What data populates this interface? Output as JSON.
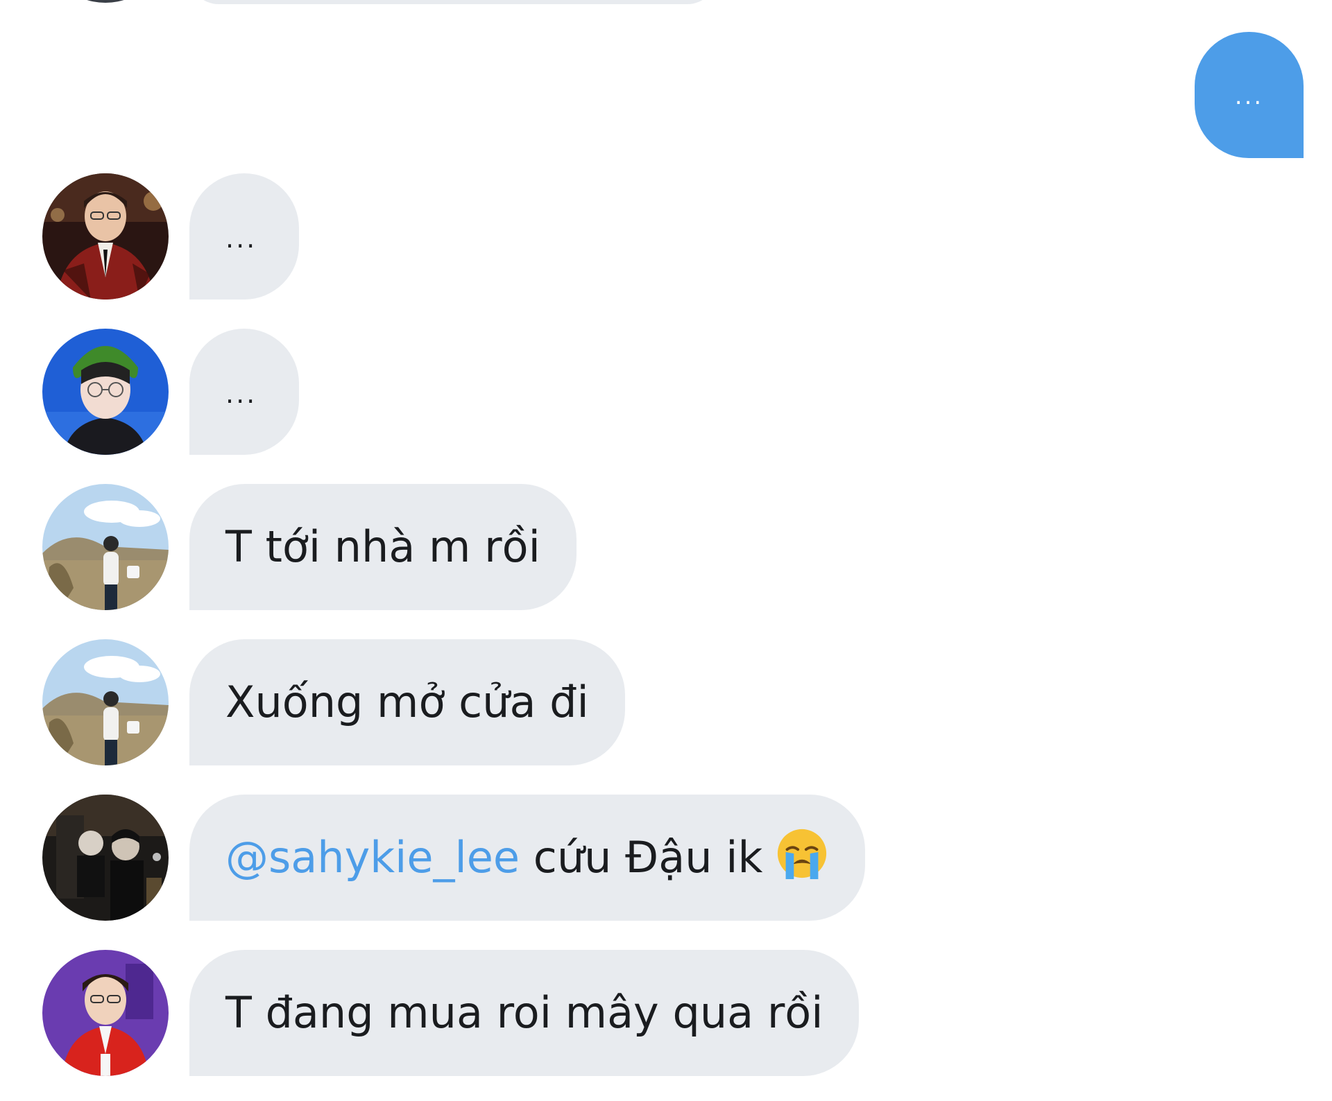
{
  "conversation": {
    "outgoing": {
      "text": "..."
    },
    "messages": [
      {
        "avatar": "avatar-red-jacket",
        "text": "..."
      },
      {
        "avatar": "avatar-green-beanie",
        "text": "..."
      },
      {
        "avatar": "avatar-field-photo",
        "text": "T tới nhà m rồi"
      },
      {
        "avatar": "avatar-field-photo",
        "text": "Xuống mở cửa đi"
      },
      {
        "avatar": "avatar-dark-photo",
        "mention": "@sahykie_lee",
        "text": " cứu Đậu ik",
        "emoji": "loudly-crying-face-icon"
      },
      {
        "avatar": "avatar-purple-red",
        "text": "T đang mua roi mây qua rồi"
      }
    ]
  },
  "colors": {
    "outgoing_bubble": "#4d9de8",
    "incoming_bubble": "#e8ebef",
    "mention": "#4d9de8",
    "text": "#1a1c1f"
  }
}
